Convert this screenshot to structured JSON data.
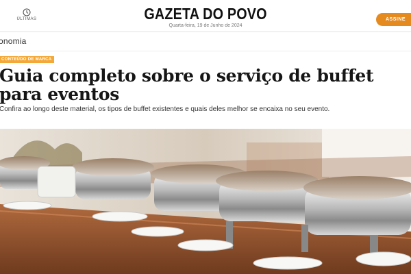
{
  "header": {
    "ultimas_label": "ÚLTIMAS",
    "logo": "GAZETA DO POVO",
    "date": "Quarta-feira, 19 de Junho de 2024",
    "subscribe_label": "ASSINE"
  },
  "section": {
    "label": "onomia"
  },
  "article": {
    "badge": "CONTEÚDO DE MARCA",
    "title": "Guia completo sobre o serviço de buffet para eventos",
    "summary": "Confira ao longo deste material, os tipos de buffet existentes e quais deles melhor se encaixa no seu evento."
  },
  "colors": {
    "accent": "#e58a1f",
    "badge": "#f4a838"
  },
  "icons": {
    "ultimas": "clock-icon"
  }
}
